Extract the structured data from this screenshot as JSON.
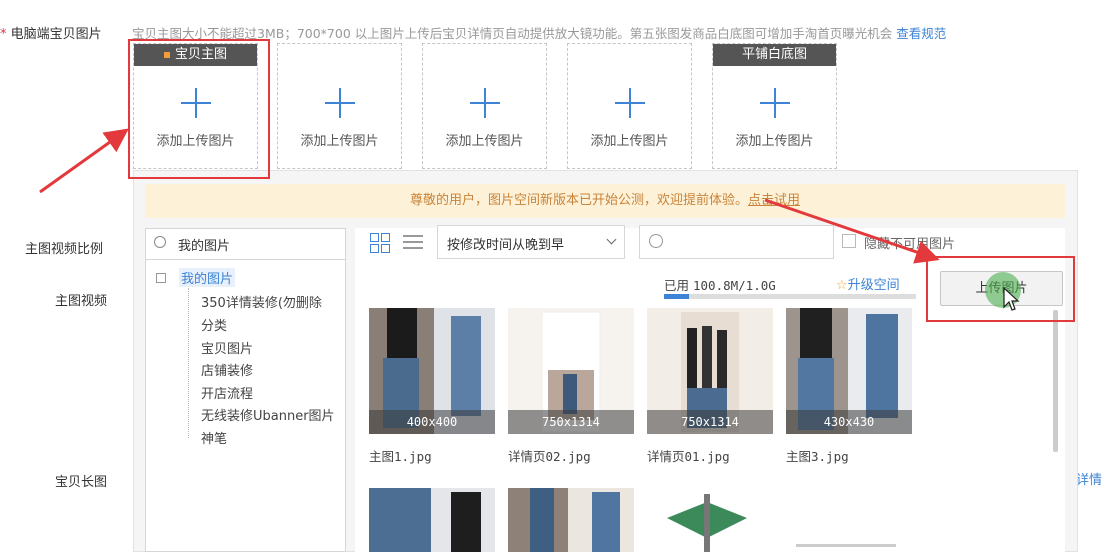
{
  "form": {
    "required_mark": "*",
    "pc_images_label": "电脑端宝贝图片",
    "pc_images_hint": "宝贝主图大小不能超过3MB；700*700 以上图片上传后宝贝详情页自动提供放大镜功能。第五张图发商品白底图可增加手淘首页曝光机会",
    "pc_images_link": "查看规范",
    "video_ratio_label": "主图视频比例",
    "video_label": "主图视频",
    "long_image_label": "宝贝长图",
    "right_edge_link": "详情"
  },
  "slots": [
    {
      "tag": "宝贝主图",
      "text": "添加上传图片"
    },
    {
      "tag": "",
      "text": "添加上传图片"
    },
    {
      "tag": "",
      "text": "添加上传图片"
    },
    {
      "tag": "",
      "text": "添加上传图片"
    },
    {
      "tag": "平铺白底图",
      "text": "添加上传图片"
    }
  ],
  "picker": {
    "notice_text": "尊敬的用户，图片空间新版本已开始公测，欢迎提前体验。",
    "notice_link": "点击试用",
    "search_value": "我的图片",
    "sort_value": "按修改时间从晚到早",
    "hide_unavailable": "隐藏不可用图片",
    "usage_label": "已用",
    "usage_value": "100.8M/1.0G",
    "usage_fraction": 0.1,
    "upgrade_link": "升级空间",
    "upload_button": "上传图片",
    "tree_root": "我的图片",
    "tree_items": [
      "350详情装修(勿删除",
      "分类",
      "宝贝图片",
      "店铺装修",
      "开店流程",
      "无线装修Ubanner图片",
      "神笔"
    ],
    "images": [
      {
        "size": "400x400",
        "name": "主图1.jpg"
      },
      {
        "size": "750x1314",
        "name": "详情页02.jpg"
      },
      {
        "size": "750x1314",
        "name": "详情页01.jpg"
      },
      {
        "size": "430x430",
        "name": "主图3.jpg"
      }
    ]
  },
  "colors": {
    "accent": "#3d84d6",
    "highlight": "#e4393c",
    "notice_bg": "#fdf2d8"
  }
}
